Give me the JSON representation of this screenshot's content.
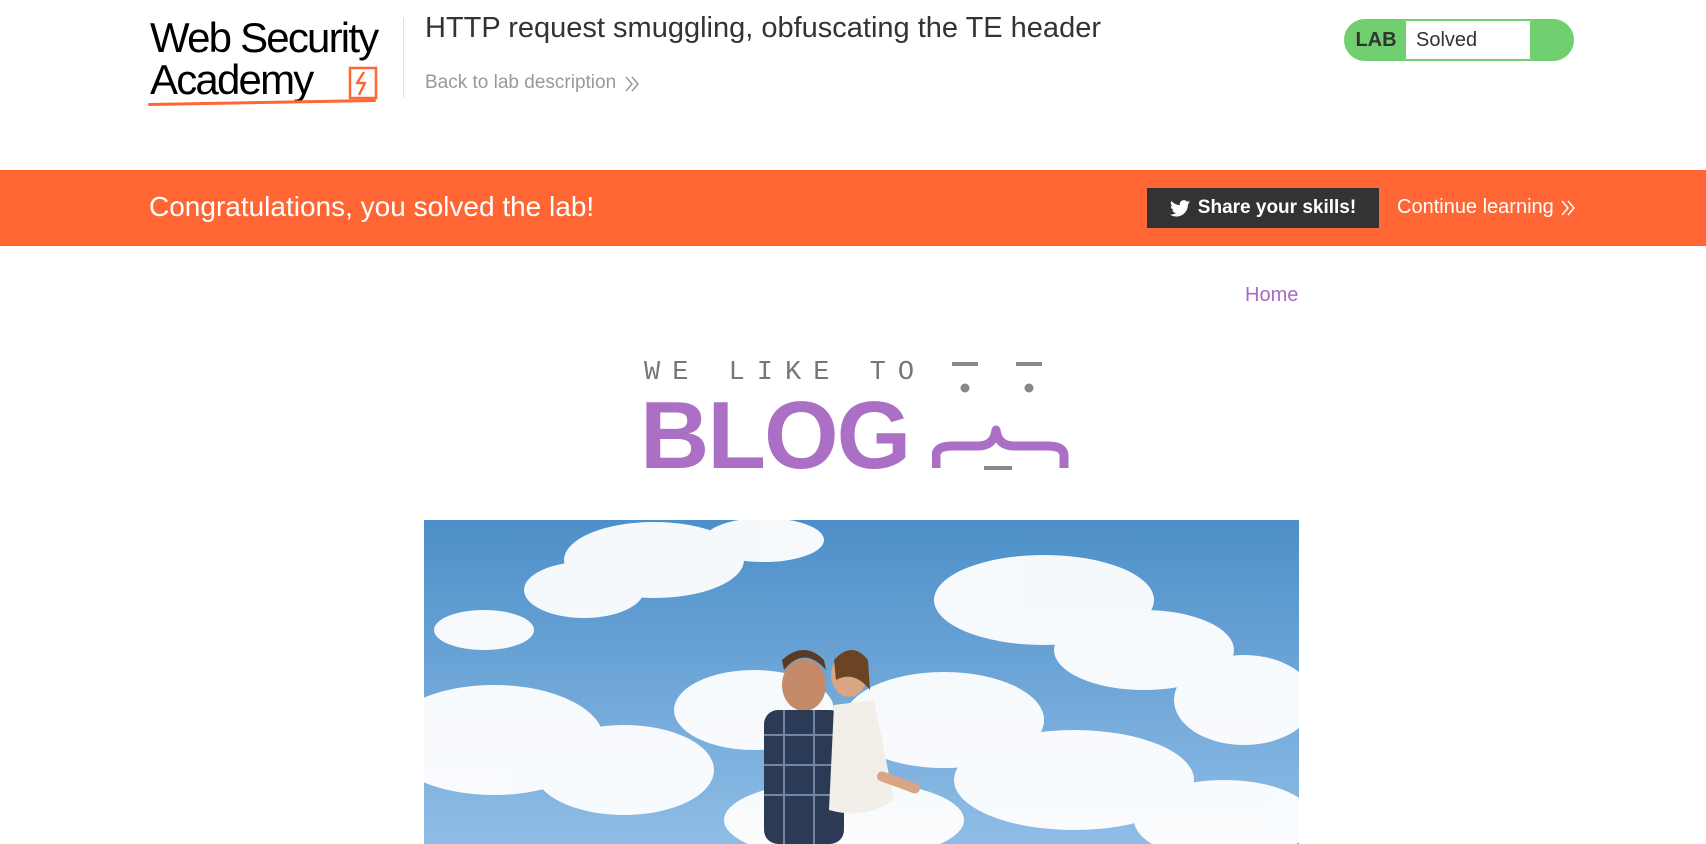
{
  "academy": {
    "logo": {
      "line1": "Web Security",
      "line2": "Academy"
    },
    "lab_title": "HTTP request smuggling, obfuscating the TE header",
    "back_link": "Back to lab description",
    "lab_badge": "LAB",
    "lab_status": "Solved"
  },
  "banner": {
    "message": "Congratulations, you solved the lab!",
    "share_button": "Share your skills!",
    "continue_link": "Continue learning"
  },
  "blog": {
    "nav": {
      "home": "Home"
    },
    "tagline": "WE LIKE TO",
    "title": "BLOG"
  },
  "colors": {
    "accent_orange": "#ff6633",
    "solved_green": "#70d070",
    "blog_purple": "#ab70c6",
    "share_button_bg": "#333333"
  },
  "icons": [
    "chevron-double-right-icon",
    "twitter-icon",
    "logo-bolt-icon",
    "blog-face-icon"
  ]
}
